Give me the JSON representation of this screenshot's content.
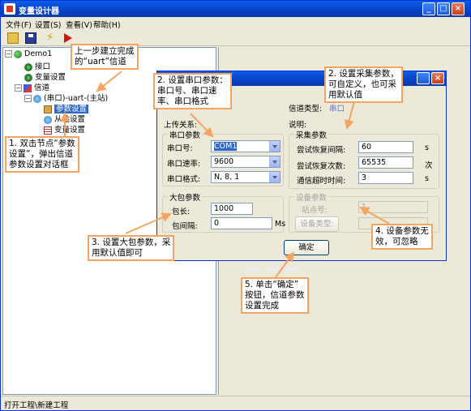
{
  "window": {
    "title": "变量设计器",
    "buttons": {
      "minimize": "_",
      "maximize": "□",
      "close": "×"
    }
  },
  "menu": [
    "文件(F)",
    "设置(S)",
    "查看(V)",
    "帮助(H)"
  ],
  "toolbar": {
    "icons": [
      "open-folder-icon",
      "save-icon",
      "build-icon",
      "run-icon"
    ]
  },
  "tree": {
    "root": "Demo1",
    "n_interface": "接口",
    "n_vars": "变量设置",
    "n_channel": "信道",
    "n_uart": "(串口)-uart-(主站)",
    "n_param": "参数设置",
    "n_slave": "从站设置",
    "n_var": "变量设置"
  },
  "dialog": {
    "channel_type_label": "信道类型:",
    "channel_type_value": "串口",
    "upload_label": "上传关系:",
    "desc_label": "说明:",
    "serial_group": "串口参数",
    "port_label": "串口号:",
    "port_value": "COM1",
    "baud_label": "串口速率:",
    "baud_value": "9600",
    "format_label": "串口格式:",
    "format_value": "N, 8, 1",
    "collect_group": "采集参数",
    "retry_interval_label": "尝试恢复间隔:",
    "retry_interval_value": "60",
    "retry_interval_unit": "s",
    "retry_count_label": "尝试恢复次数:",
    "retry_count_value": "65535",
    "retry_count_unit": "次",
    "timeout_label": "通信超时时间:",
    "timeout_value": "3",
    "timeout_unit": "s",
    "bigpkg_group": "大包参数",
    "pkg_len_label": "包长:",
    "pkg_len_value": "1000",
    "pkg_gap_label": "包间隔:",
    "pkg_gap_value": "0",
    "pkg_gap_unit": "Ms",
    "device_group": "设备参数",
    "station_label": "站点号:",
    "station_value": "1",
    "device_type_button": "设备类型:",
    "ok_button": "确定"
  },
  "callouts": {
    "c_top": "上一步建立完成\n的“uart”信道",
    "c1": "1. 双击节点“参数\n设置”，弹出信道\n参数设置对话框",
    "c2": "2. 设置串口参数：\n串口号、串口速\n率、串口格式",
    "c_collect": "2. 设置采集参数，\n可自定义，也可采\n用默认值",
    "c3": "3. 设置大包参数，采\n用默认值即可",
    "c4": "4. 设备参数无\n效，可忽略",
    "c5": "5. 单击“确定”\n按钮，信道参数\n设置完成"
  },
  "status": "打开工程\\新建工程",
  "colors": {
    "callout_border": "#f4a460",
    "titlebar": "#0842c4",
    "selection": "#316ac5"
  }
}
